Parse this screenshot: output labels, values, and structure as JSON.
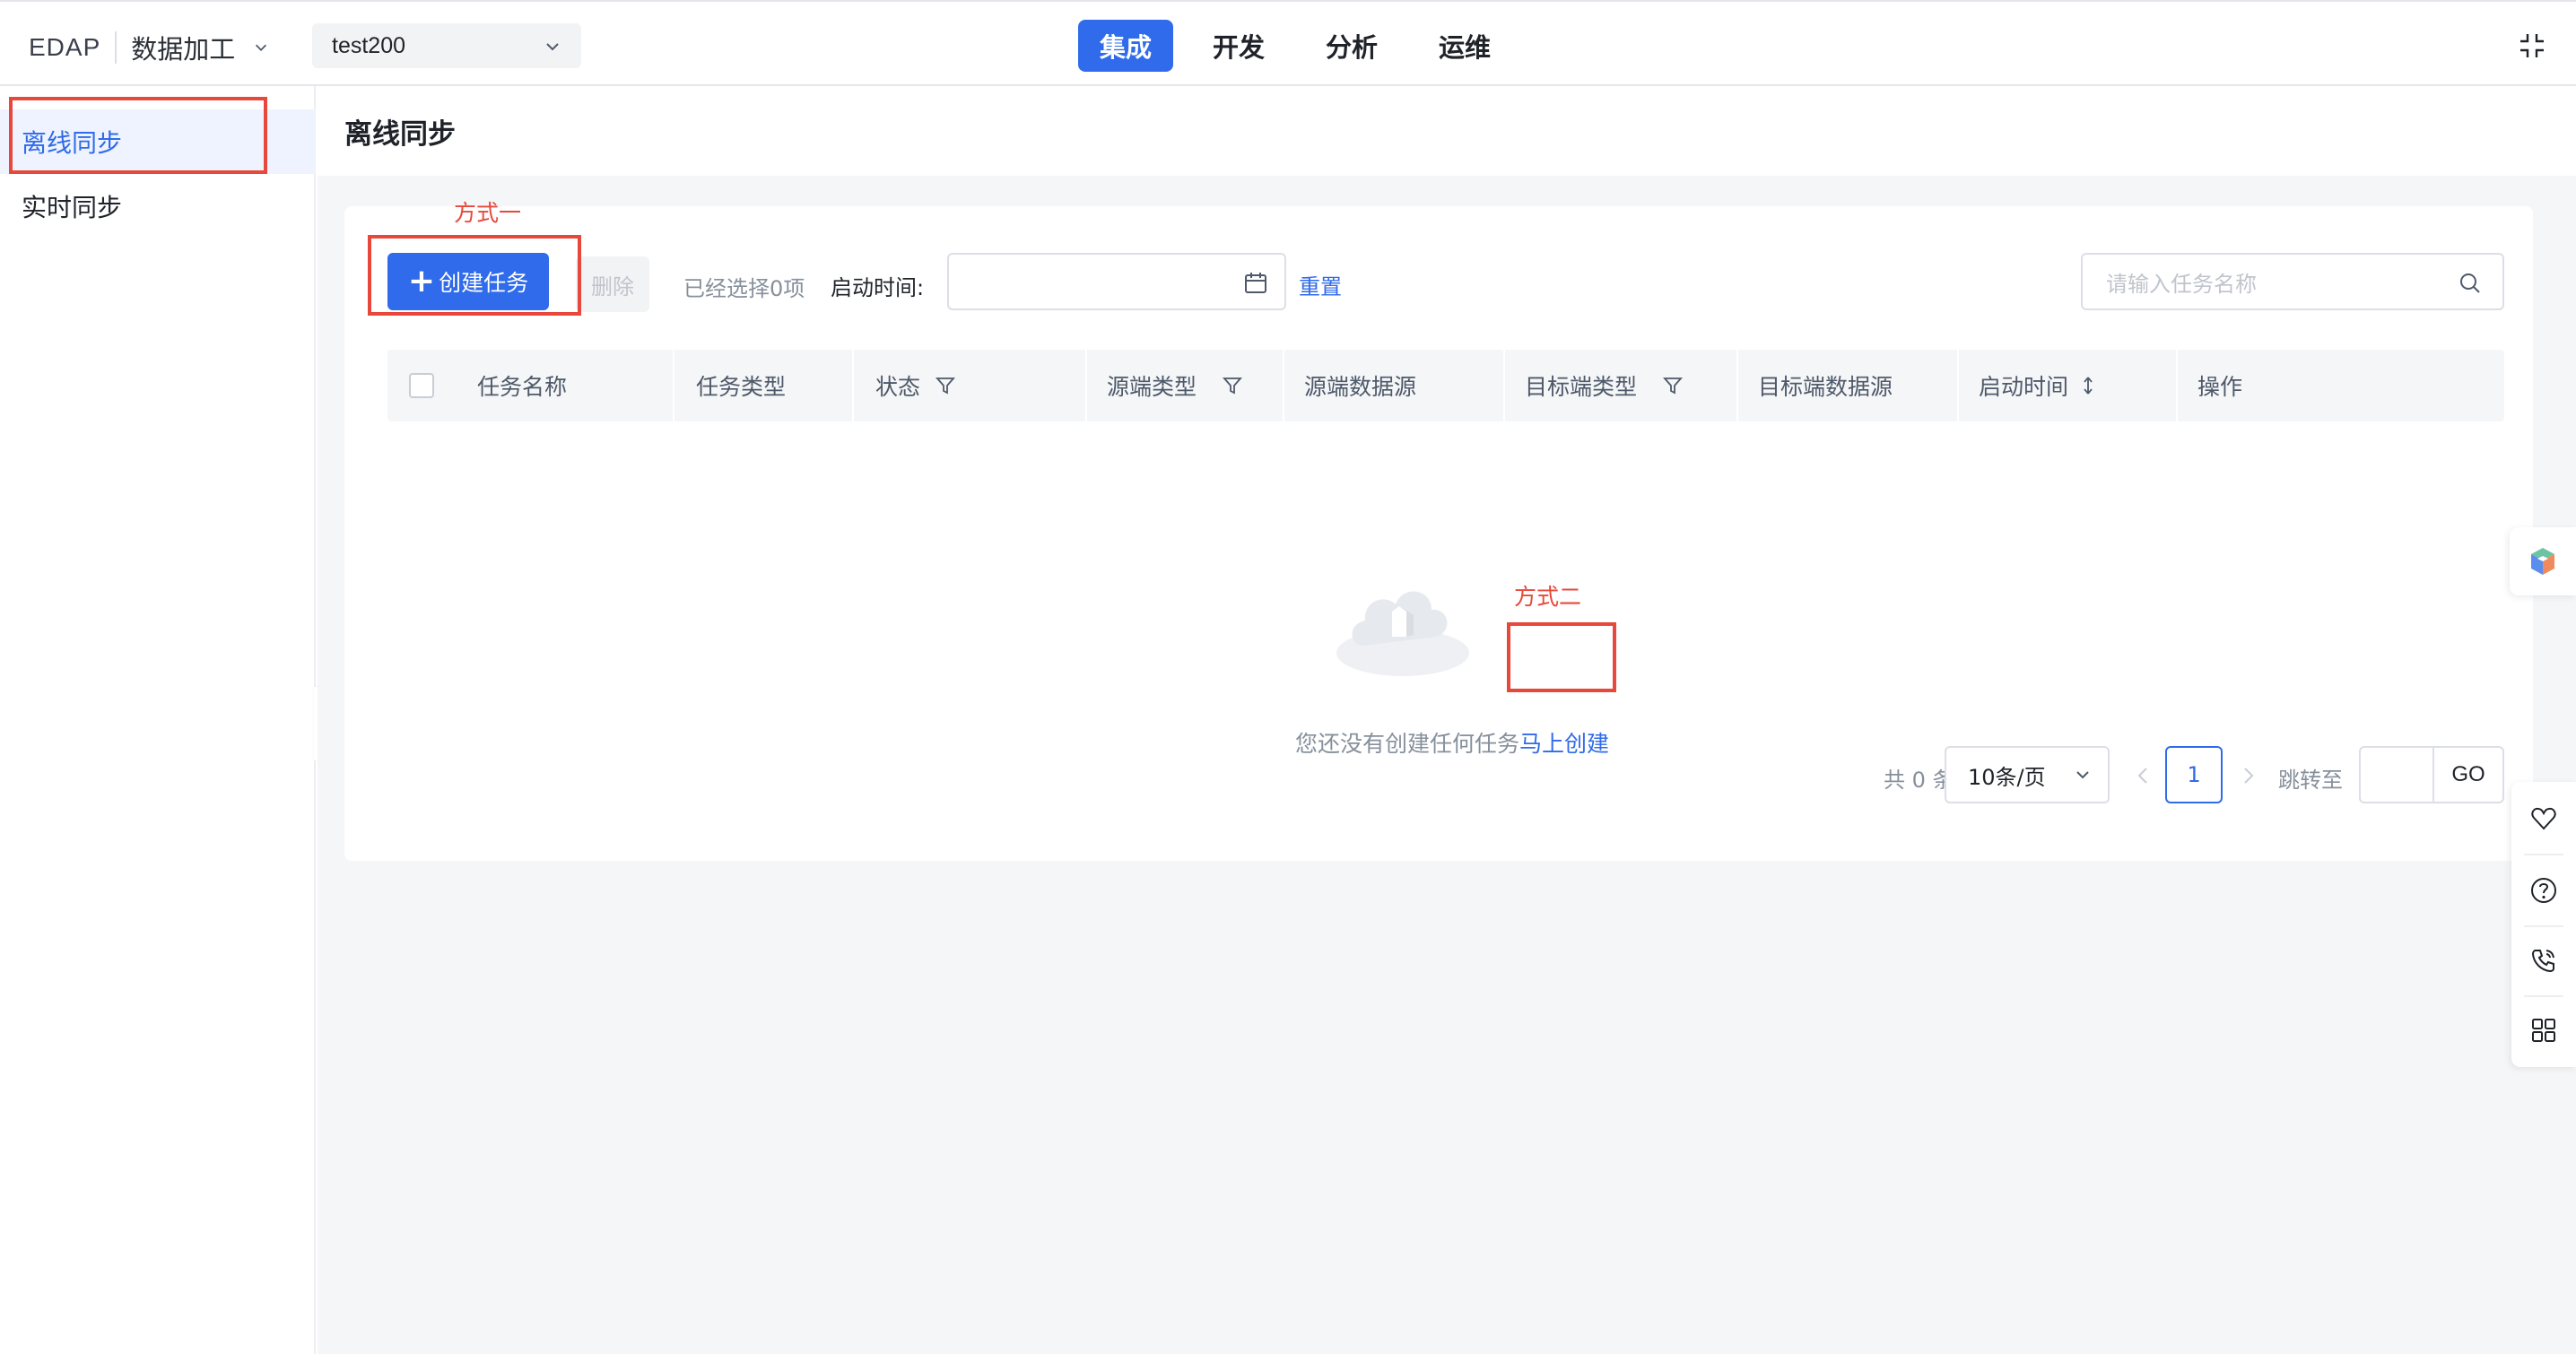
{
  "header": {
    "brand": "EDAP",
    "product": "数据加工",
    "project": "test200",
    "tabs": [
      {
        "label": "集成",
        "active": true
      },
      {
        "label": "开发",
        "active": false
      },
      {
        "label": "分析",
        "active": false
      },
      {
        "label": "运维",
        "active": false
      }
    ]
  },
  "sidebar": {
    "items": [
      {
        "label": "离线同步",
        "active": true
      },
      {
        "label": "实时同步",
        "active": false
      }
    ]
  },
  "page": {
    "title": "离线同步"
  },
  "toolbar": {
    "create_label": "创建任务",
    "delete_label": "删除",
    "selected_text": "已经选择0项",
    "time_label": "启动时间:",
    "reset_label": "重置",
    "search_placeholder": "请输入任务名称"
  },
  "table": {
    "columns": [
      {
        "label": "任务名称",
        "icon": ""
      },
      {
        "label": "任务类型",
        "icon": ""
      },
      {
        "label": "状态",
        "icon": "filter-icon"
      },
      {
        "label": "源端类型",
        "icon": "filter-icon"
      },
      {
        "label": "源端数据源",
        "icon": ""
      },
      {
        "label": "目标端类型",
        "icon": "filter-icon"
      },
      {
        "label": "目标端数据源",
        "icon": ""
      },
      {
        "label": "启动时间",
        "icon": "sort-icon"
      },
      {
        "label": "操作",
        "icon": ""
      }
    ],
    "rows": []
  },
  "empty": {
    "text": "您还没有创建任何任务",
    "link": "马上创建"
  },
  "pagination": {
    "total_text": "共 0 条",
    "page_size": "10条/页",
    "current_page": "1",
    "goto_label": "跳转至",
    "go_label": "GO"
  },
  "annotations": {
    "method_one": "方式一",
    "method_two": "方式二"
  },
  "colors": {
    "primary": "#2f6bea",
    "annotation": "#e8483b",
    "background": "#f5f6f8"
  }
}
